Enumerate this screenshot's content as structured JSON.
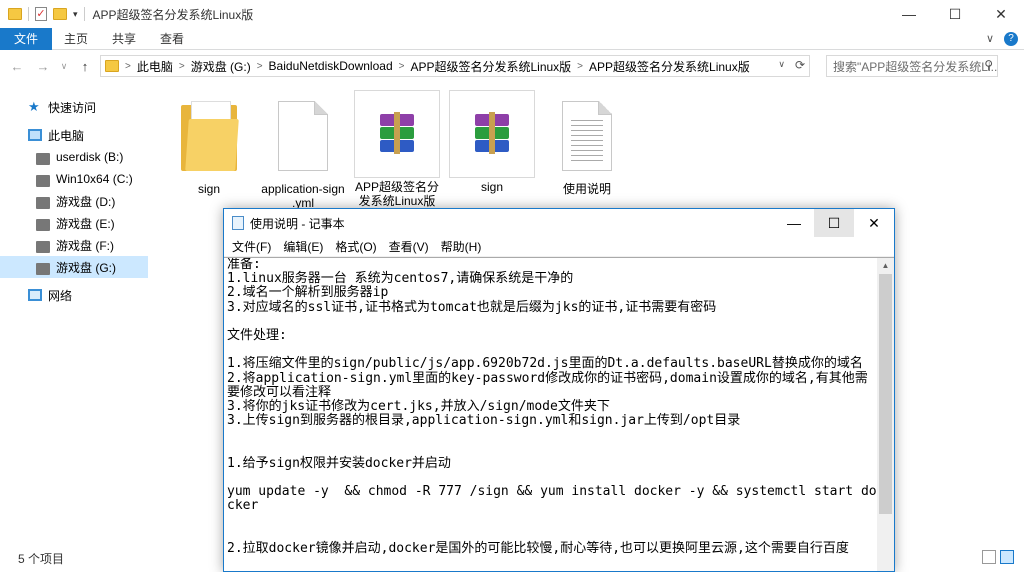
{
  "explorer": {
    "title": "APP超级签名分发系统Linux版",
    "window_controls": {
      "minimize": "—",
      "maximize": "☐",
      "close": "✕"
    },
    "ribbon_tabs": [
      "文件",
      "主页",
      "共享",
      "查看"
    ],
    "ribbon_right": {
      "expand": "∨",
      "help": "?"
    },
    "nav_buttons": {
      "back": "←",
      "forward": "→",
      "recent": "∨",
      "up": "↑"
    },
    "address": {
      "crumbs": [
        "此电脑",
        "游戏盘 (G:)",
        "BaiduNetdiskDownload",
        "APP超级签名分发系统Linux版",
        "APP超级签名分发系统Linux版"
      ],
      "separator": ">",
      "dropdown": "∨",
      "refresh": "⟳"
    },
    "search": {
      "placeholder": "搜索\"APP超级签名分发系统Li...",
      "icon": "⚲"
    },
    "nav_pane": [
      {
        "label": "快速访问",
        "icon": "star-icon"
      },
      {
        "label": "此电脑",
        "icon": "computer-icon"
      },
      {
        "label": "userdisk (B:)",
        "icon": "drive-icon"
      },
      {
        "label": "Win10x64 (C:)",
        "icon": "drive-icon"
      },
      {
        "label": "游戏盘 (D:)",
        "icon": "drive-icon"
      },
      {
        "label": "游戏盘 (E:)",
        "icon": "drive-icon"
      },
      {
        "label": "游戏盘 (F:)",
        "icon": "drive-icon"
      },
      {
        "label": "游戏盘 (G:)",
        "icon": "drive-icon",
        "selected": true
      },
      {
        "label": "网络",
        "icon": "network-icon"
      }
    ],
    "files": [
      {
        "name": "sign",
        "type": "folder"
      },
      {
        "name": "application-sign.yml",
        "display": "application-sign\n.yml",
        "type": "document"
      },
      {
        "name": "APP超级签名分发系统Linux版",
        "display": "APP超级签名分\n发系统Linux版",
        "type": "archive"
      },
      {
        "name": "sign",
        "type": "archive"
      },
      {
        "name": "使用说明",
        "type": "text-document"
      }
    ],
    "status": "5 个项目"
  },
  "notepad": {
    "title": "使用说明 - 记事本",
    "window_controls": {
      "minimize": "—",
      "maximize": "☐",
      "close": "✕"
    },
    "menu": [
      "文件(F)",
      "编辑(E)",
      "格式(O)",
      "查看(V)",
      "帮助(H)"
    ],
    "scroll_up": "▲",
    "lines": [
      "准备:",
      "1.linux服务器一台 系统为centos7,请确保系统是干净的",
      "2.域名一个解析到服务器ip",
      "3.对应域名的ssl证书,证书格式为tomcat也就是后缀为jks的证书,证书需要有密码",
      "",
      "文件处理:",
      "",
      "1.将压缩文件里的sign/public/js/app.6920b72d.js里面的Dt.a.defaults.baseURL替换成你的域名",
      "2.将application-sign.yml里面的key-password修改成你的证书密码,domain设置成你的域名,有其他需要修改可以看注释",
      "3.将你的jks证书修改为cert.jks,并放入/sign/mode文件夹下",
      "3.上传sign到服务器的根目录,application-sign.yml和sign.jar上传到/opt目录",
      "",
      "",
      "1.给予sign权限并安装docker并启动",
      "",
      "yum update -y  && chmod -R 777 /sign && yum install docker -y && systemctl start docker",
      "",
      "",
      "2.拉取docker镜像并启动,docker是国外的可能比较慢,耐心等待,也可以更换阿里云源,这个需要自行百度"
    ]
  }
}
